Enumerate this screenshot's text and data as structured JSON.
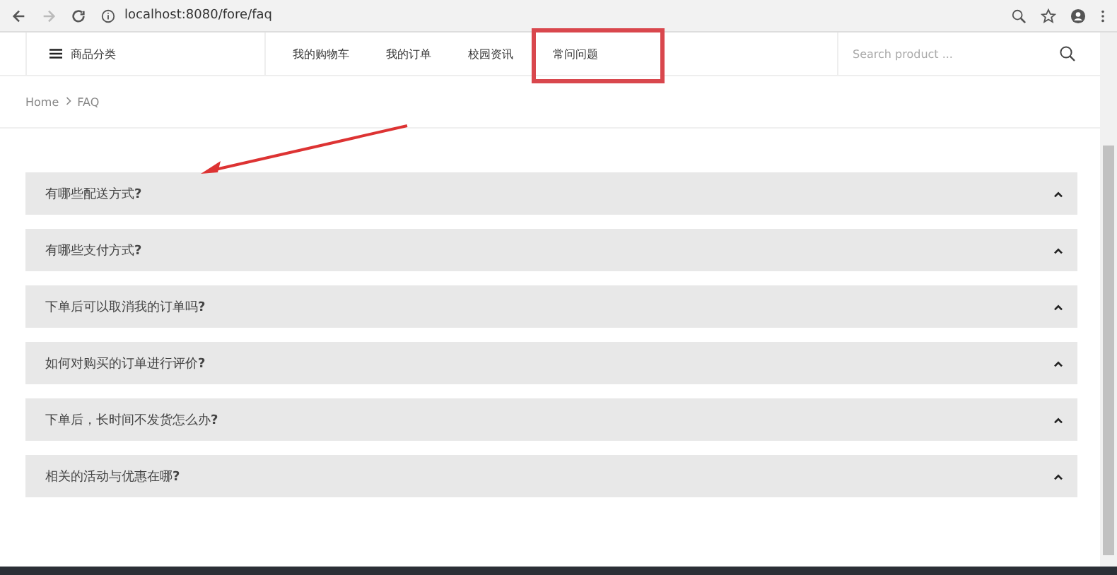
{
  "browser": {
    "url": "localhost:8080/fore/faq"
  },
  "nav": {
    "category": "商品分类",
    "items": [
      {
        "label": "我的购物车",
        "highlighted": false
      },
      {
        "label": "我的订单",
        "highlighted": false
      },
      {
        "label": "校园资讯",
        "highlighted": false
      },
      {
        "label": "常问问题",
        "highlighted": true
      }
    ],
    "search": {
      "placeholder": "Search product ..."
    }
  },
  "breadcrumb": [
    "Home",
    "FAQ"
  ],
  "faq": [
    {
      "question": "有哪些配送方式**?**"
    },
    {
      "question": "有哪些支付方式**?**"
    },
    {
      "question": "下单后可以取消我的订单吗**?**"
    },
    {
      "question": "如何对购买的订单进行评价**?**"
    },
    {
      "question": "下单后，长时间不发货怎么办**?**"
    },
    {
      "question": "相关的活动与优惠在哪**?**"
    }
  ]
}
